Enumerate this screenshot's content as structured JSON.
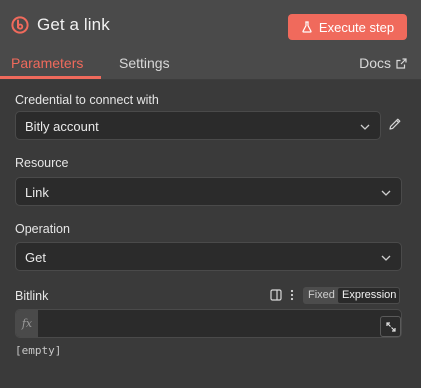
{
  "header": {
    "title": "Get a link",
    "execute_label": "Execute step",
    "accent": "#f06a5c"
  },
  "tabs": [
    {
      "label": "Parameters",
      "active": true
    },
    {
      "label": "Settings",
      "active": false
    }
  ],
  "docs_label": "Docs",
  "fields": {
    "credential": {
      "label": "Credential to connect with",
      "value": "Bitly account"
    },
    "resource": {
      "label": "Resource",
      "value": "Link"
    },
    "operation": {
      "label": "Operation",
      "value": "Get"
    },
    "bitlink": {
      "label": "Bitlink",
      "mode_fixed": "Fixed",
      "mode_expression": "Expression",
      "fx": "fx",
      "value": "",
      "hint": "[empty]"
    }
  }
}
